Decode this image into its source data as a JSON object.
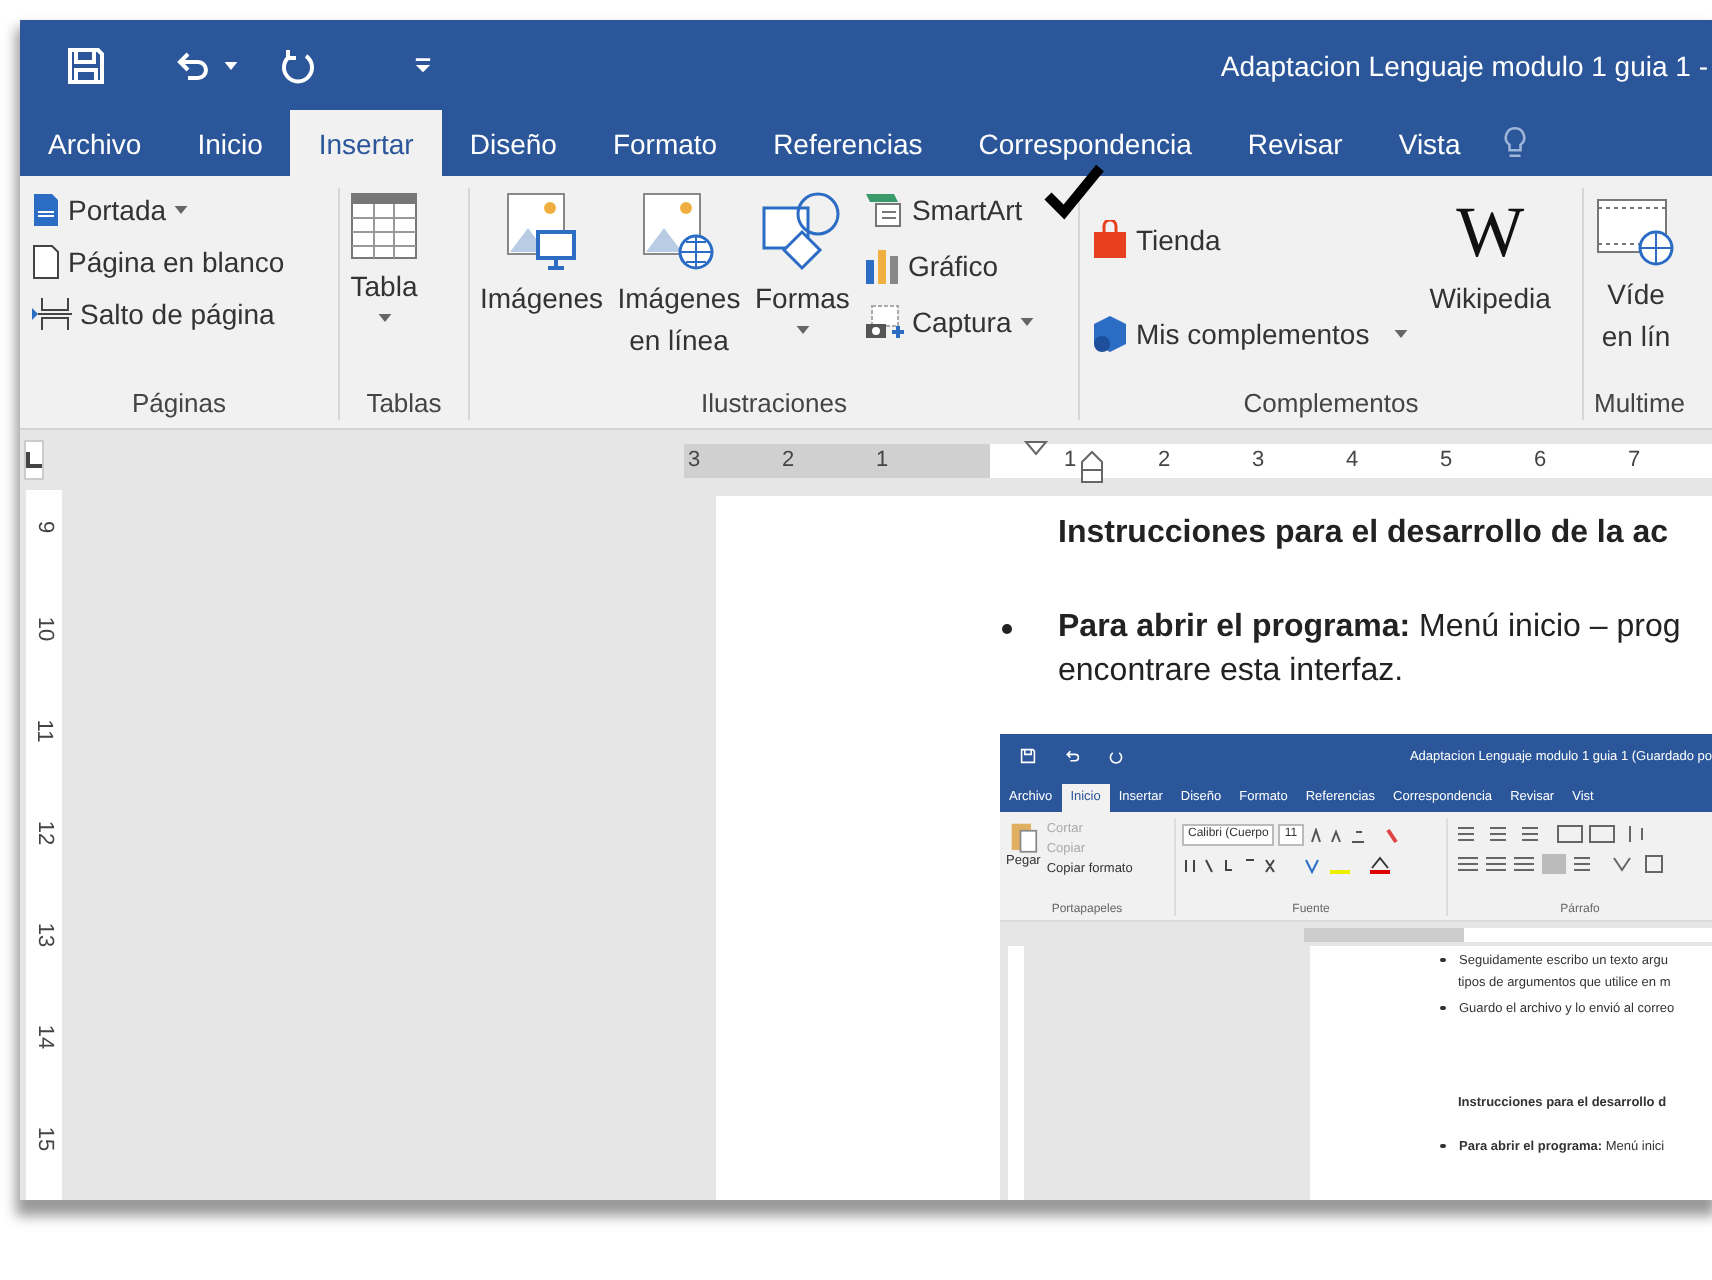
{
  "title_bar": {
    "title": "Adaptacion Lenguaje modulo 1 guia 1 -"
  },
  "tabs": [
    {
      "label": "Archivo",
      "selected": false
    },
    {
      "label": "Inicio",
      "selected": false
    },
    {
      "label": "Insertar",
      "selected": true
    },
    {
      "label": "Diseño",
      "selected": false
    },
    {
      "label": "Formato",
      "selected": false
    },
    {
      "label": "Referencias",
      "selected": false
    },
    {
      "label": "Correspondencia",
      "selected": false
    },
    {
      "label": "Revisar",
      "selected": false
    },
    {
      "label": "Vista",
      "selected": false
    }
  ],
  "ribbon": [
    {
      "label": "Páginas",
      "items": [
        {
          "label": "Portada",
          "dropdown": true
        },
        {
          "label": "Página en blanco",
          "dropdown": false
        },
        {
          "label": "Salto de página",
          "dropdown": false
        }
      ]
    },
    {
      "label": "Tablas",
      "items": [
        {
          "label": "Tabla",
          "dropdown": true
        }
      ]
    },
    {
      "label": "Ilustraciones",
      "items": [
        {
          "label": "Imágenes",
          "dropdown": false
        },
        {
          "label": "Imágenes en línea",
          "dropdown": false
        },
        {
          "label": "Formas",
          "dropdown": true
        },
        {
          "label": "SmartArt",
          "dropdown": false
        },
        {
          "label": "Gráfico",
          "dropdown": false
        },
        {
          "label": "Captura",
          "dropdown": true
        }
      ]
    },
    {
      "label": "Complementos",
      "items": [
        {
          "label": "Tienda",
          "dropdown": false
        },
        {
          "label": "Mis complementos",
          "dropdown": true
        },
        {
          "label": "Wikipedia",
          "glyph": "W",
          "dropdown": false
        }
      ]
    },
    {
      "label": "Multime",
      "items": [
        {
          "label": "Víde en lín",
          "dropdown": false
        }
      ]
    }
  ],
  "ruler": {
    "left_numbers": [
      "3",
      "2",
      "1"
    ],
    "right_numbers": [
      "1",
      "2",
      "3",
      "4",
      "5",
      "6",
      "7"
    ],
    "vertical_numbers": [
      "9",
      "10",
      "11",
      "12",
      "13",
      "14",
      "15"
    ]
  },
  "document": {
    "lines": [
      {
        "kind": "heading",
        "text": "Instrucciones para el desarrollo de la ac"
      },
      {
        "kind": "bullet",
        "text": "**Para abrir el programa:** Menú inicio – prog"
      },
      {
        "kind": "continuation",
        "text": "encontrare esta interfaz."
      }
    ]
  },
  "embedded_screenshot": {
    "title": "Adaptacion Lenguaje modulo 1 guia 1 (Guardado po",
    "tabs": [
      {
        "label": "Archivo",
        "selected": false
      },
      {
        "label": "Inicio",
        "selected": true
      },
      {
        "label": "Insertar",
        "selected": false
      },
      {
        "label": "Diseño",
        "selected": false
      },
      {
        "label": "Formato",
        "selected": false
      },
      {
        "label": "Referencias",
        "selected": false
      },
      {
        "label": "Correspondencia",
        "selected": false
      },
      {
        "label": "Revisar",
        "selected": false
      },
      {
        "label": "Vist",
        "selected": false
      }
    ],
    "clipboard": {
      "paste": "Pegar",
      "items": [
        {
          "label": "Cortar",
          "disabled": true
        },
        {
          "label": "Copiar",
          "disabled": true
        },
        {
          "label": "Copiar formato",
          "disabled": false
        }
      ],
      "label": "Portapapeles"
    },
    "font": {
      "name": "Calibri (Cuerpo",
      "size": "11",
      "label": "Fuente"
    },
    "paragraph": {
      "label": "Párrafo"
    },
    "lines": [
      {
        "kind": "bullet",
        "text": "Seguidamente escribo un texto argu"
      },
      {
        "kind": "continuation",
        "text": "tipos de argumentos que utilice en m"
      },
      {
        "kind": "bullet",
        "text": "Guardo el archivo y lo envió al correo"
      },
      {
        "kind": "heading",
        "text": "Instrucciones para el desarrollo d"
      },
      {
        "kind": "bullet",
        "text": "**Para abrir el programa:** Menú inici"
      }
    ]
  }
}
